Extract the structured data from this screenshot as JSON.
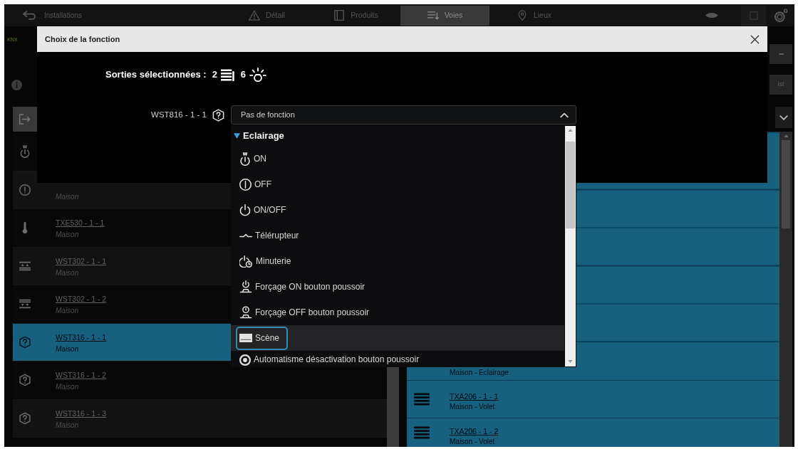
{
  "top_bar": {
    "back_label": "Installations",
    "tabs": [
      {
        "label": "Détail",
        "kind": "detail",
        "selected": false
      },
      {
        "label": "Produits",
        "kind": "products",
        "selected": false
      },
      {
        "label": "Voies",
        "kind": "channels",
        "selected": true
      },
      {
        "label": "Lieux",
        "kind": "places",
        "selected": false
      }
    ]
  },
  "sidebar": {
    "badge": "KNX"
  },
  "channel_list": {
    "rows": [
      {
        "kind": "light",
        "selected": false
      },
      {
        "kind": "alert",
        "subtitle": "Maison",
        "selected": false
      },
      {
        "kind": "temperature",
        "title": "TXE530 - 1 - 1",
        "subtitle": "Maison",
        "selected": false
      },
      {
        "kind": "blind_up",
        "title": "WST302 - 1 - 1",
        "subtitle": "Maison",
        "selected": false
      },
      {
        "kind": "blind_down",
        "title": "WST302 - 1 - 2",
        "subtitle": "Maison",
        "selected": false
      },
      {
        "kind": "unknown",
        "title": "WST316 - 1 - 1",
        "subtitle": "Maison",
        "selected": true
      },
      {
        "kind": "unknown",
        "title": "WST316 - 1 - 2",
        "subtitle": "Maison",
        "selected": false
      },
      {
        "kind": "unknown",
        "title": "WST316 - 1 - 3",
        "subtitle": "Maison",
        "selected": false
      }
    ]
  },
  "right_panel": {
    "view_button": "ist",
    "rows": [
      {
        "subtitle": "Maison - Eclairage"
      },
      {
        "kind": "shutter",
        "title": "TXA206 - 1 - 1",
        "subtitle": "Maison - Volet"
      },
      {
        "kind": "shutter",
        "title": "TXA206 - 1 - 2",
        "subtitle": "Maison - Volet"
      }
    ]
  },
  "dialog": {
    "title": "Choix de la fonction",
    "summary": {
      "label": "Sorties sélectionnées :",
      "counts": [
        {
          "kind": "shutter",
          "value": "2"
        },
        {
          "kind": "light",
          "value": "6"
        }
      ]
    },
    "output": {
      "label": "WST816 - 1 - 1",
      "select": {
        "value": "Pas de fonction",
        "expanded": true
      },
      "menu": {
        "group": {
          "label": "Eclairage",
          "expanded": true
        },
        "items": [
          {
            "kind": "on",
            "label": "ON",
            "selected": false
          },
          {
            "kind": "off",
            "label": "OFF",
            "selected": false
          },
          {
            "kind": "onoff",
            "label": "ON/OFF",
            "selected": false
          },
          {
            "kind": "toggle",
            "label": "Télérupteur",
            "selected": false
          },
          {
            "kind": "timer",
            "label": "Minuterie",
            "selected": false
          },
          {
            "kind": "force_on",
            "label": "Forçage ON bouton poussoir",
            "selected": false
          },
          {
            "kind": "force_off",
            "label": "Forçage OFF bouton poussoir",
            "selected": false
          },
          {
            "kind": "scene",
            "label": "Scène",
            "selected": true
          },
          {
            "kind": "auto",
            "label": "Automatisme désactivation bouton poussoir",
            "selected": false
          }
        ]
      }
    }
  }
}
